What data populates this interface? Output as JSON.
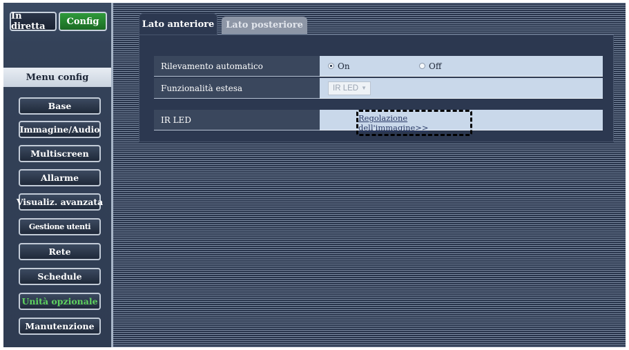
{
  "header": {
    "live_label": "In diretta",
    "config_label": "Config"
  },
  "sidebar": {
    "title": "Menu config",
    "items": [
      {
        "label": "Base"
      },
      {
        "label": "Immagine/Audio"
      },
      {
        "label": "Multiscreen"
      },
      {
        "label": "Allarme"
      },
      {
        "label": "Visualiz. avanzata"
      },
      {
        "label": "Gestione utenti"
      },
      {
        "label": "Rete"
      },
      {
        "label": "Schedule"
      },
      {
        "label": "Unità opzionale"
      },
      {
        "label": "Manutenzione"
      }
    ],
    "active_index": 8
  },
  "tabs": [
    {
      "label": "Lato anteriore",
      "selected": true
    },
    {
      "label": "Lato posteriore",
      "selected": false
    }
  ],
  "settings": {
    "auto_detect": {
      "label": "Rilevamento automatico",
      "option_on": "On",
      "option_off": "Off",
      "selected": "On"
    },
    "extended": {
      "label": "Funzionalità estesa",
      "value": "IR LED"
    },
    "ir_led": {
      "label": "IR LED",
      "link_text": "Regolazione dell'immagine>>"
    }
  },
  "colors": {
    "config_active": "#2f9a3a",
    "active_menu_text": "#5fd35f",
    "value_background": "#c9d8ea"
  }
}
